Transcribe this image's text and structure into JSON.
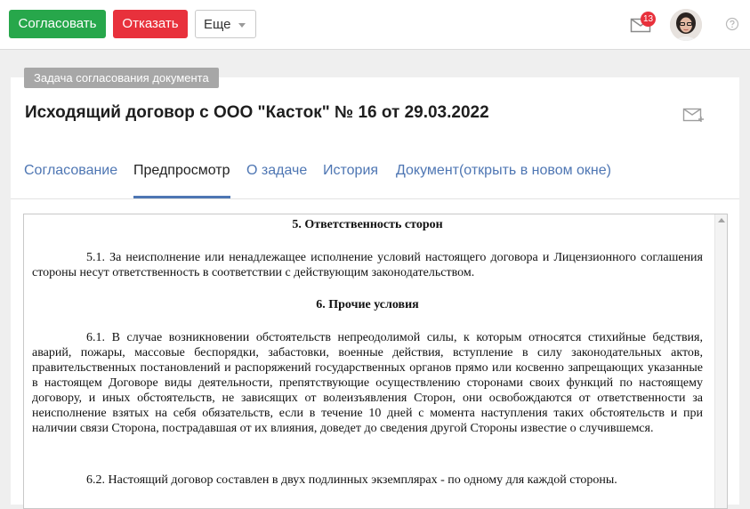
{
  "toolbar": {
    "approve_label": "Согласовать",
    "reject_label": "Отказать",
    "more_label": "Еще",
    "notifications_count": "13"
  },
  "card": {
    "task_label": "Задача согласования документа",
    "title": "Исходящий договор с ООО \"Касток\" № 16 от 29.03.2022"
  },
  "tabs": [
    {
      "label": "Согласование",
      "active": false
    },
    {
      "label": "Предпросмотр",
      "active": true
    },
    {
      "label": "О задаче",
      "active": false
    },
    {
      "label": "История",
      "active": false
    },
    {
      "label": "Документ(открыть в новом окне)",
      "active": false
    }
  ],
  "document": {
    "section5_title": "5. Ответственность сторон",
    "section5_p1": "5.1. За неисполнение или ненадлежащее исполнение условий настоящего договора и Лицензионного соглашения стороны несут ответственность в соответствии с действующим законодательством.",
    "section6_title": "6. Прочие условия",
    "section6_p1": "6.1. В случае возникновении обстоятельств непреодолимой силы, к которым относятся стихийные бедствия, аварий, пожары, массовые беспорядки, забастовки, военные действия, вступление в силу законодательных актов, правительственных постановлений и распоряжений государственных органов прямо или косвенно запрещающих указанные в настоящем Договоре виды деятельности, препятствующие осуществлению сторонами своих функций по настоящему договору, и иных обстоятельств, не зависящих от волеизъявления Сторон, они освобождаются от ответственности за неисполнение взятых на себя обязательств, если в течение 10 дней с момента наступления таких обстоятельств и при наличии связи Сторона, пострадавшая от их влияния, доведет до сведения другой Стороны известие о случившемся.",
    "section6_p2": "6.2. Настоящий договор составлен в двух подлинных экземплярах - по одному для каждой стороны."
  },
  "colors": {
    "approve": "#27a74b",
    "reject": "#e8313c",
    "tab_link": "#4e76b3",
    "task_label_bg": "#a7a7a7"
  }
}
